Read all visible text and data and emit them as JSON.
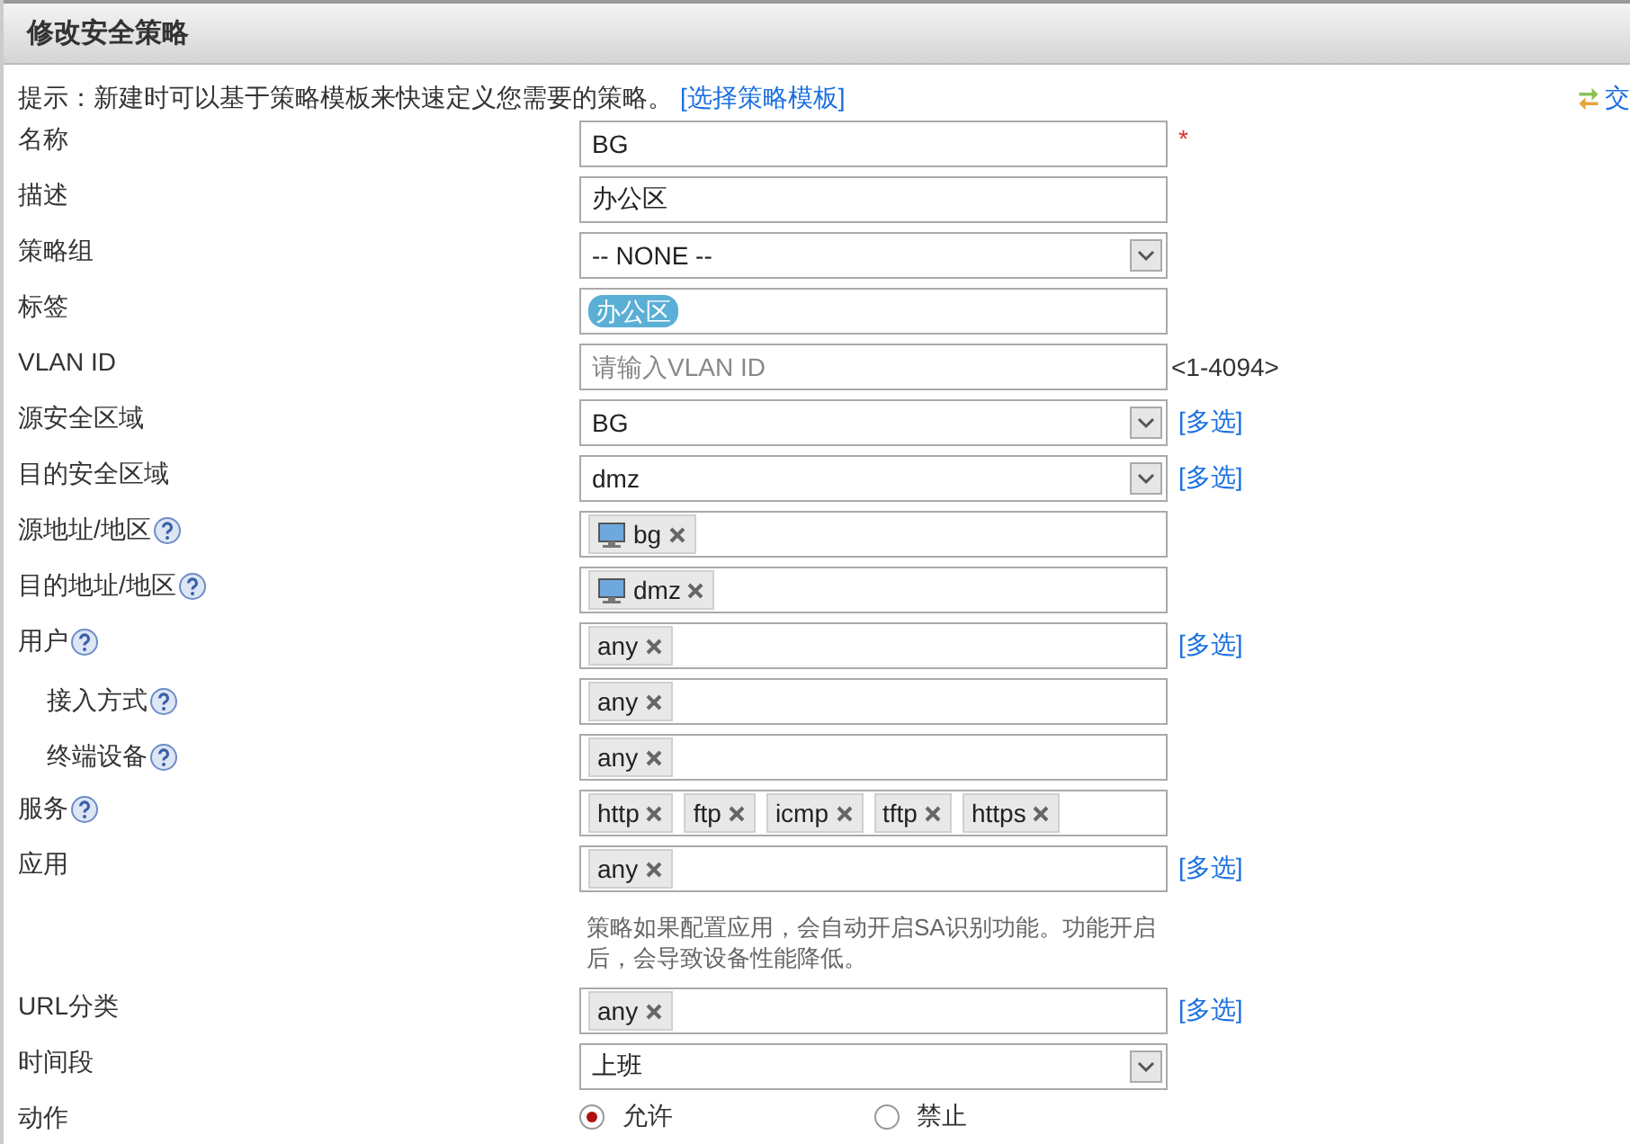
{
  "dialog": {
    "title": "修改安全策略",
    "hint": {
      "text": "提示：新建时可以基于策略模板来快速定义您需要的策略。",
      "link": "[选择策略模板]"
    },
    "corner_link": "交"
  },
  "fields": [
    {
      "kind": "text",
      "label": "名称",
      "value": "BG",
      "required_mark": "*",
      "help": false
    },
    {
      "kind": "text",
      "label": "描述",
      "value": "办公区",
      "help": false
    },
    {
      "kind": "select",
      "label": "策略组",
      "value": "-- NONE --",
      "help": false
    },
    {
      "kind": "labels",
      "label": "标签",
      "tags": [
        "办公区"
      ],
      "help": false
    },
    {
      "kind": "text",
      "label": "VLAN ID",
      "placeholder": "请输入VLAN ID",
      "suffix": "<1-4094>",
      "help": false
    },
    {
      "kind": "select",
      "label": "源安全区域",
      "value": "BG",
      "link": "[多选]",
      "help": false
    },
    {
      "kind": "select",
      "label": "目的安全区域",
      "value": "dmz",
      "link": "[多选]",
      "help": false
    },
    {
      "kind": "hosts",
      "label": "源地址/地区",
      "tags": [
        "bg"
      ],
      "help": true
    },
    {
      "kind": "hosts",
      "label": "目的地址/地区",
      "tags": [
        "dmz"
      ],
      "help": true
    },
    {
      "kind": "tokens",
      "label": "用户",
      "tags": [
        "any"
      ],
      "link": "[多选]",
      "help": true,
      "children": [
        {
          "kind": "tokens",
          "label": "接入方式",
          "tags": [
            "any"
          ],
          "help": true
        },
        {
          "kind": "tokens",
          "label": "终端设备",
          "tags": [
            "any"
          ],
          "help": true
        }
      ]
    },
    {
      "kind": "tokens",
      "label": "服务",
      "tags": [
        "http",
        "ftp",
        "icmp",
        "tftp",
        "https"
      ],
      "help": true
    },
    {
      "kind": "tokens",
      "label": "应用",
      "tags": [
        "any"
      ],
      "link": "[多选]",
      "note": "策略如果配置应用，会自动开启SA识别功能。功能开启后，会导致设备性能降低。",
      "help": false
    },
    {
      "kind": "tokens",
      "label": "URL分类",
      "tags": [
        "any"
      ],
      "link": "[多选]",
      "help": false
    },
    {
      "kind": "select",
      "label": "时间段",
      "value": "上班",
      "help": false
    },
    {
      "kind": "radio",
      "label": "动作",
      "options": [
        {
          "label": "允许",
          "selected": true
        },
        {
          "label": "禁止",
          "selected": false
        }
      ],
      "help": false
    }
  ]
}
